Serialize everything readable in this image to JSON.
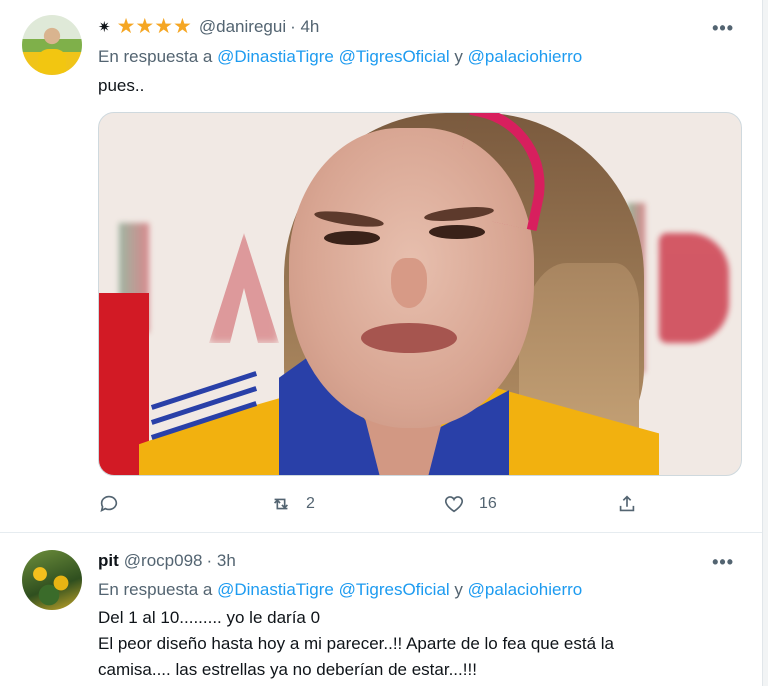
{
  "tweets": [
    {
      "display_prefix": "✷",
      "stars": "★★★★",
      "handle": "@daniregui",
      "time": "· 4h",
      "reply_prefix": "En respuesta a",
      "reply_mentions_1": "@DinastiaTigre @TigresOficial",
      "reply_and": "y",
      "reply_mentions_2": "@palaciohierro",
      "text_lines": [
        "pues.."
      ],
      "actions": {
        "reply_count": "",
        "retweet_count": "2",
        "like_count": "16"
      }
    },
    {
      "name": "pit",
      "handle": "@rocp098",
      "time": "· 3h",
      "reply_prefix": "En respuesta a",
      "reply_mentions_1": "@DinastiaTigre @TigresOficial",
      "reply_and": "y",
      "reply_mentions_2": "@palaciohierro",
      "text_lines": [
        "Del 1 al 10......... yo le daría 0",
        "El peor diseño hasta hoy a mi parecer..!!  Aparte de lo fea que está la",
        "camisa.... las estrellas ya no deberían de estar...!!!"
      ]
    }
  ],
  "more_label": "•••",
  "icons": {
    "reply": "reply-icon",
    "retweet": "retweet-icon",
    "like": "heart-icon",
    "share": "share-icon"
  },
  "colors": {
    "link": "#1d9bf0",
    "secondary_text": "#536471",
    "star": "#f5a623"
  }
}
